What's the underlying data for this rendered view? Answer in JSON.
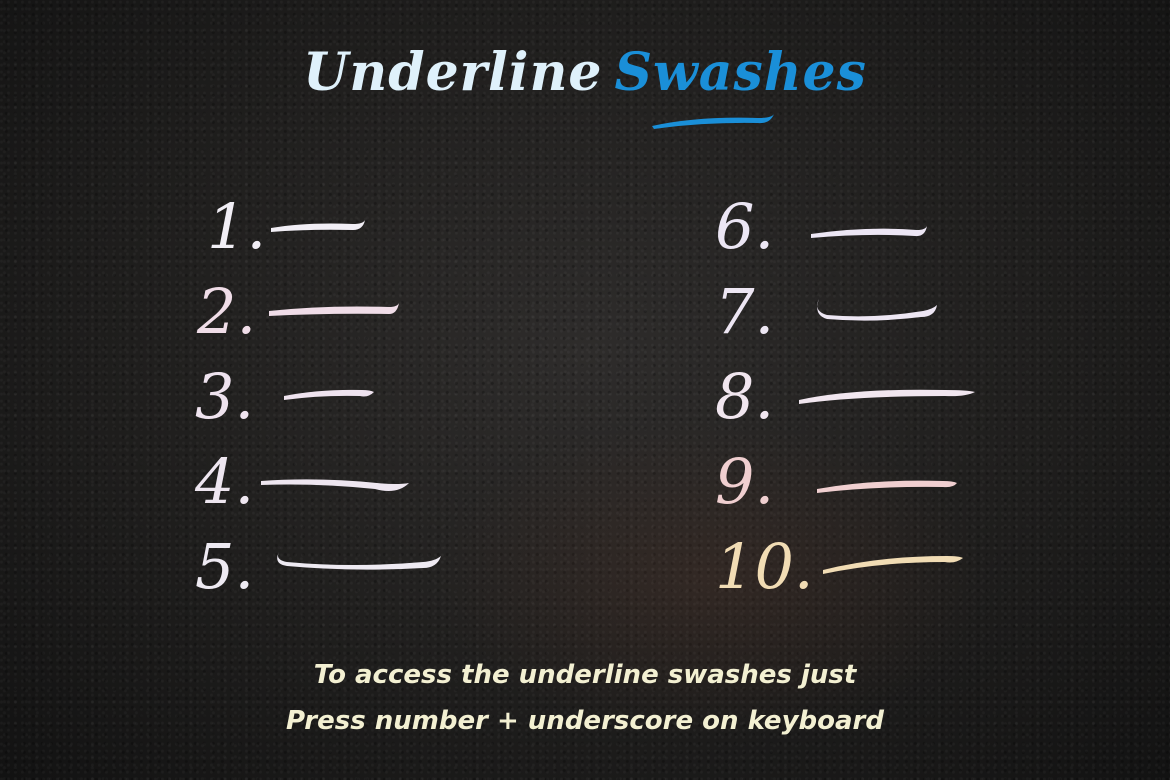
{
  "title": {
    "word1": "Underline",
    "word2": "Swashes"
  },
  "colors": {
    "background": "#1f1e1d",
    "title_word1": "#dff1fb",
    "title_word2": "#1a8fd8",
    "caption": "#f3f0d2"
  },
  "left_items": [
    {
      "label": "1.",
      "color": "#f1eef5"
    },
    {
      "label": "2.",
      "color": "#f0dde8"
    },
    {
      "label": "3.",
      "color": "#efe3ef"
    },
    {
      "label": "4.",
      "color": "#eee6f0"
    },
    {
      "label": "5.",
      "color": "#eeeaf2"
    }
  ],
  "right_items": [
    {
      "label": "6.",
      "color": "#ece6f4"
    },
    {
      "label": "7.",
      "color": "#ede6f3"
    },
    {
      "label": "8.",
      "color": "#f1e6ef"
    },
    {
      "label": "9.",
      "color": "#f0cfd0"
    },
    {
      "label": "10.",
      "color": "#f1dcb4"
    }
  ],
  "caption": {
    "line1": "To access the underline swashes just",
    "line2": "Press number + underscore on keyboard"
  }
}
